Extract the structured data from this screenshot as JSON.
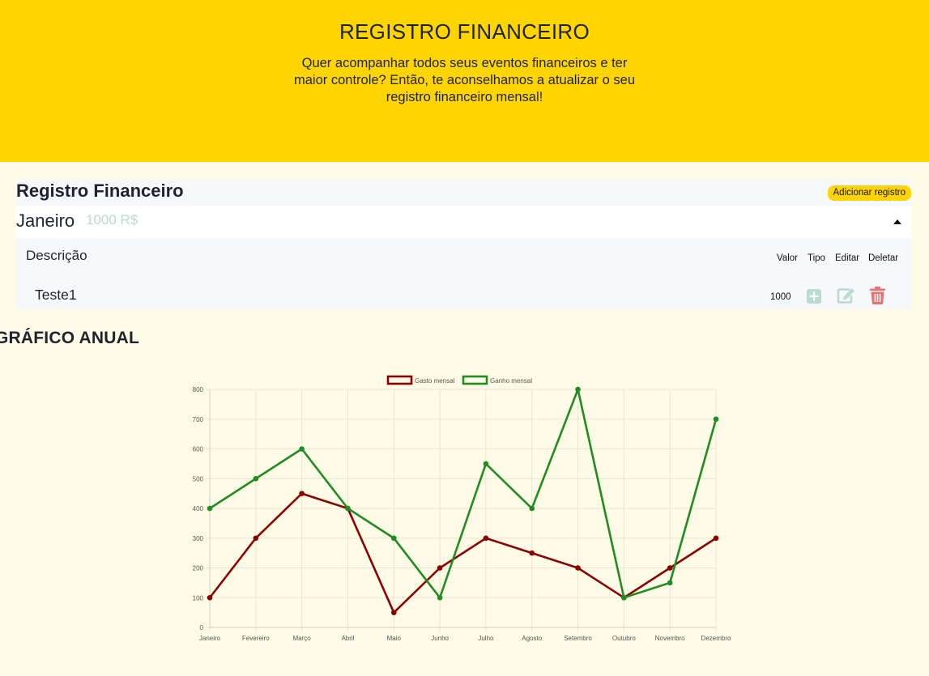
{
  "hero": {
    "title": "REGISTRO FINANCEIRO",
    "text": "Quer acompanhar todos seus eventos financeiros e ter maior controle? Então, te aconselhamos a atualizar o seu registro financeiro mensal!"
  },
  "panel": {
    "title": "Registro Financeiro",
    "add_button": "Adicionar registro",
    "month": {
      "name": "Janeiro",
      "total": "1000 R$"
    },
    "table": {
      "headers": {
        "description": "Descrição",
        "valor": "Valor",
        "tipo": "Tipo",
        "editar": "Editar",
        "deletar": "Deletar"
      },
      "rows": [
        {
          "description": "Teste1",
          "valor": "1000"
        }
      ]
    },
    "icons": {
      "tipo": "plus-square-icon",
      "editar": "edit-icon",
      "deletar": "trash-icon"
    },
    "colors": {
      "accent": "#ffd500",
      "tipo_icon": "#b8dccd",
      "edit_icon": "#b8dccd",
      "trash_icon": "#e57373"
    }
  },
  "chart_heading": "GRÁFICO ANUAL",
  "chart_data": {
    "type": "line",
    "categories": [
      "Janeiro",
      "Fevereiro",
      "Março",
      "Abril",
      "Maio",
      "Junho",
      "Julho",
      "Agosto",
      "Setembro",
      "Outubro",
      "Novembro",
      "Dezembro"
    ],
    "series": [
      {
        "name": "Gasto mensal",
        "color": "#8b0000",
        "values": [
          100,
          300,
          450,
          400,
          50,
          200,
          300,
          250,
          200,
          100,
          200,
          300
        ]
      },
      {
        "name": "Ganho mensal",
        "color": "#228b22",
        "values": [
          400,
          500,
          600,
          400,
          300,
          100,
          550,
          400,
          800,
          100,
          150,
          700
        ]
      }
    ],
    "yticks": [
      0,
      100,
      200,
      300,
      400,
      500,
      600,
      700,
      800
    ],
    "ylim": [
      0,
      800
    ],
    "grid": true,
    "legend_position": "top"
  }
}
